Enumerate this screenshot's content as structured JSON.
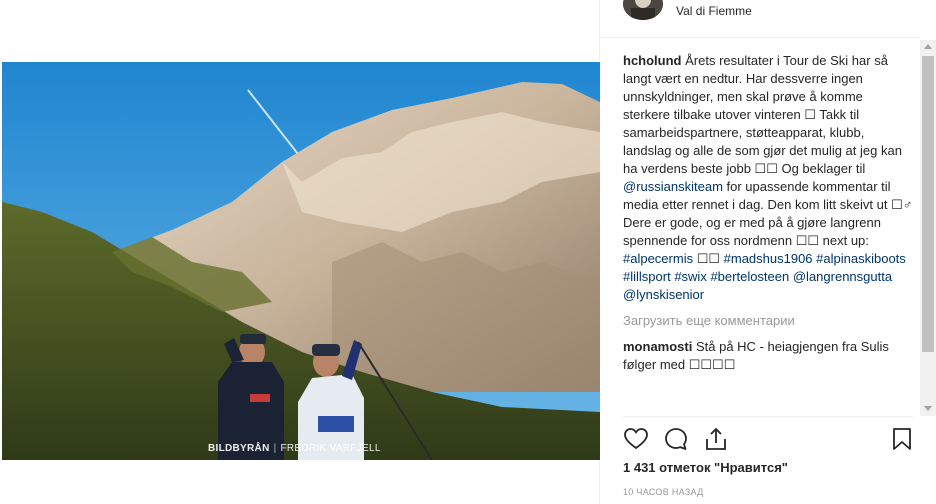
{
  "post": {
    "location": "Val di Fiemme",
    "photo": {
      "watermark_brand": "BILDBYRÅN",
      "watermark_credit": "FREDRIK VARFJELL",
      "description_icon": "mountain-photo"
    }
  },
  "caption": {
    "username": "hcholund",
    "text_1": "Årets resultater i Tour de Ski har så langt vært en nedtur. Har dessverre ingen unnskyldninger, men skal prøve å komme sterkere tilbake utover vinteren ☐ Takk til samarbeidspartnere, støtteapparat, klubb, landslag og alle de som gjør det mulig at jeg kan ha verdens beste jobb ☐☐ Og beklager til ",
    "mention_1": "@russianskiteam",
    "text_2": " for upassende kommentar til media etter rennet i dag. Den kom litt skeivt ut ☐♂ Dere er gode, og er med på å gjøre langrenn spennende for oss nordmenn ☐☐ next up: ",
    "tag_1": "#alpecermis",
    "text_3": " ☐☐ ",
    "tag_2": "#madshus1906",
    "tag_3": "#alpinaskiboots",
    "tag_4": "#lillsport",
    "tag_5": "#swix",
    "tag_6": "#bertelosteen",
    "mention_2": "@langrennsgutta",
    "mention_3": "@lynskisenior"
  },
  "load_more_label": "Загрузить еще комментарии",
  "comment": {
    "username": "monamosti",
    "text": "Stå på HC - heiagjengen fra Sulis følger med ☐☐☐☐"
  },
  "actions": {
    "like_icon": "heart-icon",
    "comment_icon": "comment-icon",
    "share_icon": "share-icon",
    "save_icon": "bookmark-icon"
  },
  "likes_text": "1 431 отметок \"Нравится\"",
  "timestamp": "10 ЧАСОВ НАЗАД",
  "colors": {
    "link": "#003569",
    "muted": "#999999",
    "text": "#262626"
  }
}
